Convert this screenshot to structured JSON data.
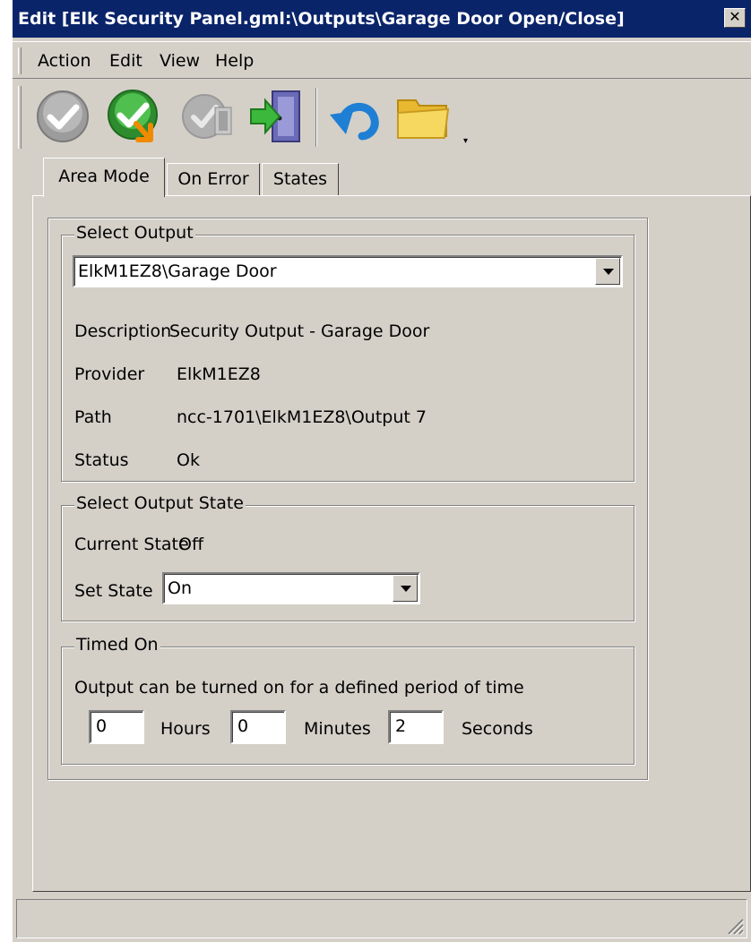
{
  "window": {
    "title": "Edit [Elk Security Panel.gml:\\Outputs\\Garage Door Open/Close]",
    "close_glyph": "✕"
  },
  "menu": {
    "items": [
      "Action",
      "Edit",
      "View",
      "Help"
    ]
  },
  "toolbar": {
    "buttons": [
      {
        "icon": "check-gray-icon"
      },
      {
        "icon": "check-green-arrow-icon"
      },
      {
        "icon": "disabled-gear-icon"
      },
      {
        "icon": "exit-door-icon"
      },
      {
        "icon": "undo-icon"
      },
      {
        "icon": "folder-icon"
      }
    ]
  },
  "tabs": [
    {
      "label": "Area Mode",
      "active": true
    },
    {
      "label": "On Error",
      "active": false
    },
    {
      "label": "States",
      "active": false
    }
  ],
  "select_output": {
    "legend": "Select Output",
    "value": "ElkM1EZ8\\Garage Door",
    "description_label": "Description",
    "description_value": "Security Output - Garage Door",
    "provider_label": "Provider",
    "provider_value": "ElkM1EZ8",
    "path_label": "Path",
    "path_value": "ncc-1701\\ElkM1EZ8\\Output 7",
    "status_label": "Status",
    "status_value": "Ok"
  },
  "output_state": {
    "legend": "Select Output State",
    "current_state_label": "Current State",
    "current_state_value": "Off",
    "set_state_label": "Set State",
    "set_state_value": "On"
  },
  "timed_on": {
    "legend": "Timed On",
    "description": "Output can be turned on for a defined period of time",
    "hours_value": "0",
    "hours_label": "Hours",
    "minutes_value": "0",
    "minutes_label": "Minutes",
    "seconds_value": "2",
    "seconds_label": "Seconds"
  },
  "colors": {
    "titlebar": "#0a246a",
    "window_face": "#d4d0c8"
  }
}
